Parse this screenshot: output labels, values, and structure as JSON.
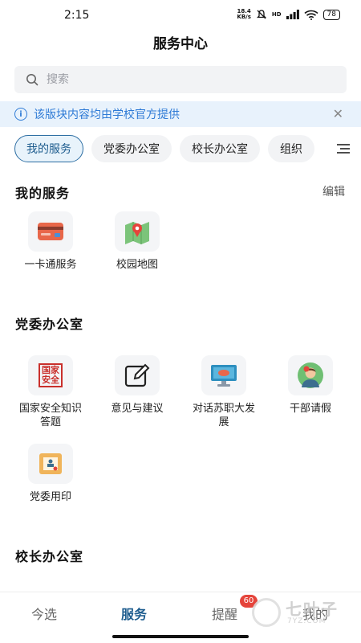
{
  "status_bar": {
    "time": "2:15",
    "net_speed_value": "18.4",
    "net_speed_unit": "KB/s",
    "hd_label": "HD",
    "battery": "78"
  },
  "header": {
    "title": "服务中心"
  },
  "search": {
    "placeholder": "搜索"
  },
  "notice": {
    "text": "该版块内容均由学校官方提供"
  },
  "tabs": [
    {
      "label": "我的服务",
      "active": true
    },
    {
      "label": "党委办公室"
    },
    {
      "label": "校长办公室"
    },
    {
      "label": "组织"
    }
  ],
  "sections": {
    "my_services": {
      "title": "我的服务",
      "edit_label": "编辑",
      "items": [
        {
          "label": "一卡通服务",
          "icon": "card-icon"
        },
        {
          "label": "校园地图",
          "icon": "map-icon"
        }
      ]
    },
    "party_office": {
      "title": "党委办公室",
      "items": [
        {
          "label": "国家安全知识答题",
          "icon": "national-security-icon",
          "icon_text": "国家安全"
        },
        {
          "label": "意见与建议",
          "icon": "edit-icon"
        },
        {
          "label": "对话苏职大发展",
          "icon": "monitor-icon"
        },
        {
          "label": "干部请假",
          "icon": "person-icon"
        },
        {
          "label": "党委用印",
          "icon": "seal-icon"
        }
      ]
    },
    "president_office": {
      "title": "校长办公室"
    }
  },
  "bottom_nav": {
    "items": [
      {
        "label": "今选"
      },
      {
        "label": "服务",
        "active": true
      },
      {
        "label": "提醒",
        "badge": "60"
      },
      {
        "label": "我的"
      }
    ]
  },
  "watermark": {
    "text": "七叶子",
    "sub": "7YZ.COM"
  },
  "colors": {
    "accent": "#1d5c8e",
    "notice": "#2f7bd6",
    "badge": "#e5443b"
  }
}
